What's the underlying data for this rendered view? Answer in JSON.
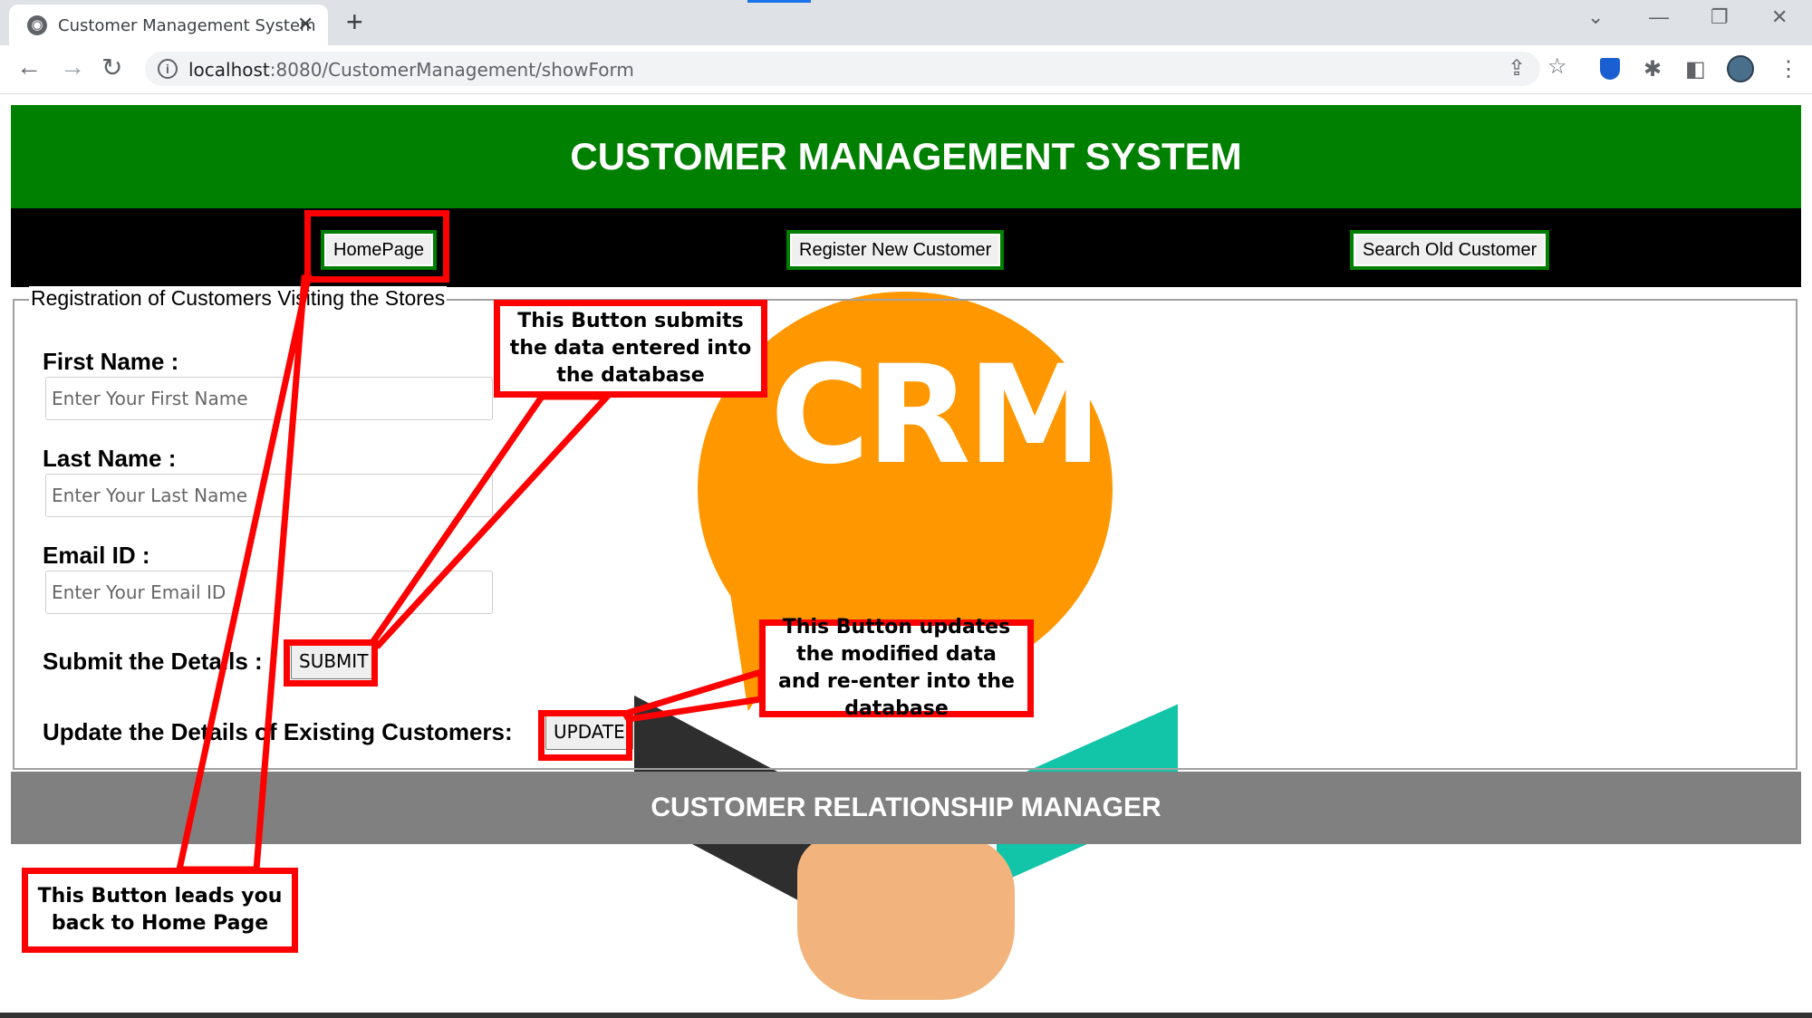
{
  "browser": {
    "tab_title": "Customer Management System",
    "tab_close": "✕",
    "new_tab": "+",
    "url_host": "localhost",
    "url_path": ":8080/CustomerManagement/showForm"
  },
  "page": {
    "header_title": "CUSTOMER MANAGEMENT SYSTEM",
    "nav": {
      "homepage": "HomePage",
      "register": "Register New Customer",
      "search": "Search Old Customer"
    },
    "form": {
      "legend": "Registration of Customers Visiting the Stores",
      "first_name_label": "First Name :",
      "first_name_placeholder": "Enter Your First Name",
      "last_name_label": "Last Name :",
      "last_name_placeholder": "Enter Your Last Name",
      "email_label": "Email ID :",
      "email_placeholder": "Enter Your Email ID",
      "submit_label": "Submit the Details :",
      "submit_button": "SUBMIT",
      "update_label": "Update the Details of Existing Customers:",
      "update_button": "UPDATE"
    },
    "illustration_text": "CRM",
    "footer": "CUSTOMER RELATIONSHIP MANAGER"
  },
  "annotations": {
    "submit_note": "This Button submits the data entered into the database",
    "update_note": "This Button updates the modified data and re-enter into the database",
    "home_note": "This Button leads you back to Home Page"
  },
  "colors": {
    "header_green": "#008000",
    "annotation_red": "#ff0000",
    "footer_gray": "#808080",
    "crm_orange": "#ff9800"
  }
}
